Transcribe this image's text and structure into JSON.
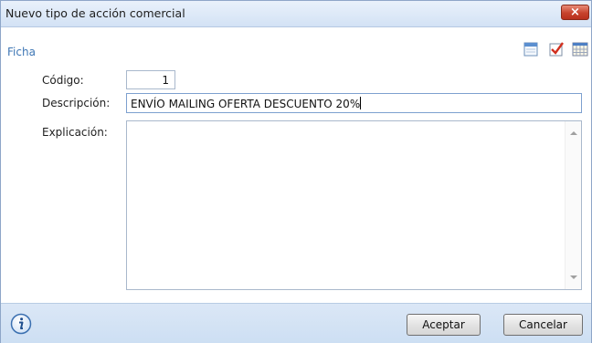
{
  "window": {
    "title": "Nuevo tipo de acción comercial",
    "close_label": "×"
  },
  "tab": {
    "label": "Ficha"
  },
  "toolbar": {
    "icons": [
      "calendar-icon",
      "checklist-icon",
      "grid-calendar-icon"
    ]
  },
  "form": {
    "codigo_label": "Código:",
    "codigo_value": "1",
    "descripcion_label": "Descripción:",
    "descripcion_value": "ENVÍO MAILING OFERTA DESCUENTO 20%",
    "explicacion_label": "Explicación:",
    "explicacion_value": ""
  },
  "footer": {
    "info_icon": "info-icon",
    "accept_label": "Aceptar",
    "cancel_label": "Cancelar"
  },
  "colors": {
    "accent": "#3f77b5",
    "titlebar": "#d3e2f5",
    "footer": "#cddff3",
    "close": "#c7432c"
  }
}
